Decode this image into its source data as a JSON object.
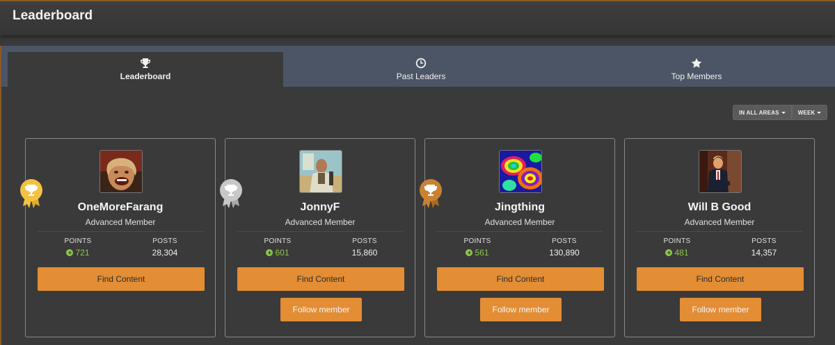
{
  "page": {
    "title": "Leaderboard"
  },
  "tabs": [
    {
      "label": "Leaderboard",
      "icon": "trophy-icon",
      "active": true
    },
    {
      "label": "Past Leaders",
      "icon": "clock-icon",
      "active": false
    },
    {
      "label": "Top Members",
      "icon": "star-icon",
      "active": false
    }
  ],
  "filters": {
    "area_label": "IN ALL AREAS",
    "period_label": "WEEK"
  },
  "colors": {
    "accent": "#e38d35",
    "points_green": "#8ec64a",
    "gold": "#f4c242",
    "silver": "#c8c8c8",
    "bronze": "#c98232"
  },
  "labels": {
    "points": "POINTS",
    "posts": "POSTS",
    "find_content": "Find Content",
    "follow_member": "Follow member"
  },
  "members": [
    {
      "rank": 1,
      "badge": "gold",
      "name": "OneMoreFarang",
      "title": "Advanced Member",
      "points": "721",
      "posts": "28,304",
      "can_follow": false
    },
    {
      "rank": 2,
      "badge": "silver",
      "name": "JonnyF",
      "title": "Advanced Member",
      "points": "601",
      "posts": "15,860",
      "can_follow": true
    },
    {
      "rank": 3,
      "badge": "bronze",
      "name": "Jingthing",
      "title": "Advanced Member",
      "points": "561",
      "posts": "130,890",
      "can_follow": true
    },
    {
      "rank": 4,
      "badge": null,
      "name": "Will B Good",
      "title": "Advanced Member",
      "points": "481",
      "posts": "14,357",
      "can_follow": true
    }
  ]
}
